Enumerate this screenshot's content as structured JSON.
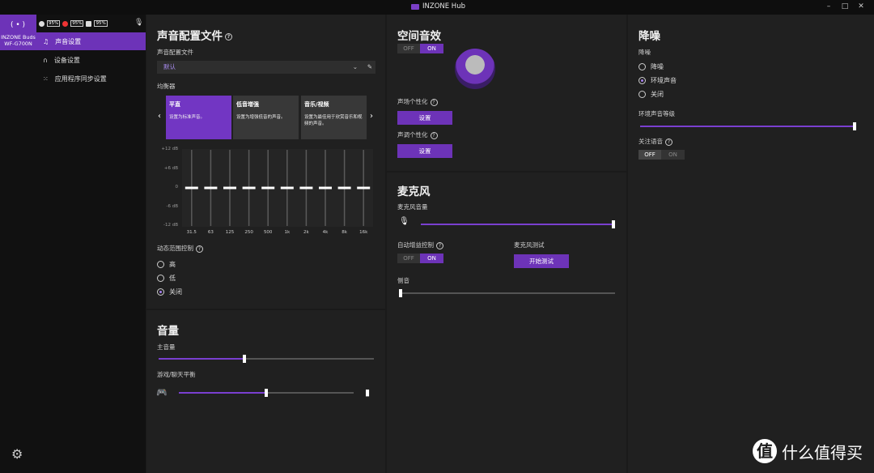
{
  "app": {
    "title": "INZONE Hub"
  },
  "window": {
    "minimize": "–",
    "maximize": "□",
    "close": "✕"
  },
  "device": {
    "name_line1": "INZONE Buds",
    "name_line2": "WF-G700N"
  },
  "battery": {
    "left": "95%",
    "right": "95%",
    "case": "95%"
  },
  "nav": [
    {
      "label": "声音设置",
      "icon": "music-note-icon"
    },
    {
      "label": "设备设置",
      "icon": "headphones-icon"
    },
    {
      "label": "应用程序同步设置",
      "icon": "grid-icon"
    }
  ],
  "sound_profile": {
    "title": "声音配置文件",
    "field_label": "声音配置文件",
    "selected": "默认",
    "eq_label": "均衡器",
    "cards": [
      {
        "title": "平直",
        "desc": "设置为标准声音。"
      },
      {
        "title": "低音增强",
        "desc": "设置为增强低音的声音。"
      },
      {
        "title": "音乐/视频",
        "desc": "设置为最佳用于欣赏音乐和视频的声音。"
      }
    ],
    "db_labels": [
      "+12 dB",
      "+6 dB",
      "0",
      "-6 dB",
      "-12 dB"
    ],
    "freqs": [
      "31.5",
      "63",
      "125",
      "250",
      "500",
      "1k",
      "2k",
      "4k",
      "8k",
      "16k"
    ],
    "eq_values_db": [
      0,
      0,
      0,
      0,
      0,
      0,
      0,
      0,
      0,
      0
    ],
    "drc_label": "动态范围控制",
    "drc_options": [
      "高",
      "低",
      "关闭"
    ],
    "drc_selected": 2
  },
  "volume": {
    "title": "音量",
    "master_label": "主音量",
    "master_value": 0.4,
    "balance_label": "游戏/聊天平衡",
    "balance_value": 0.5
  },
  "spatial": {
    "title": "空间音效",
    "toggle_off": "OFF",
    "toggle_on": "ON",
    "sound_field_label": "声场个性化",
    "sound_field_button": "设置",
    "sound_tone_label": "声调个性化",
    "sound_tone_button": "设置"
  },
  "microphone": {
    "title": "麦克风",
    "volume_label": "麦克风音量",
    "volume_value": 1.0,
    "agc_label": "自动增益控制",
    "toggle_off": "OFF",
    "toggle_on": "ON",
    "test_label": "麦克风测试",
    "test_button": "开始测试",
    "sidetone_label": "侧音",
    "sidetone_value": 0.0
  },
  "noise": {
    "title": "降噪",
    "mode_label": "降噪",
    "options": [
      "降噪",
      "环境声音",
      "关闭"
    ],
    "selected": 1,
    "ambient_label": "环境声音等级",
    "ambient_value": 1.0,
    "focus_label": "关注语音",
    "toggle_off": "OFF",
    "toggle_on": "ON"
  },
  "watermark": {
    "text": "什么值得买",
    "icon": "值"
  }
}
